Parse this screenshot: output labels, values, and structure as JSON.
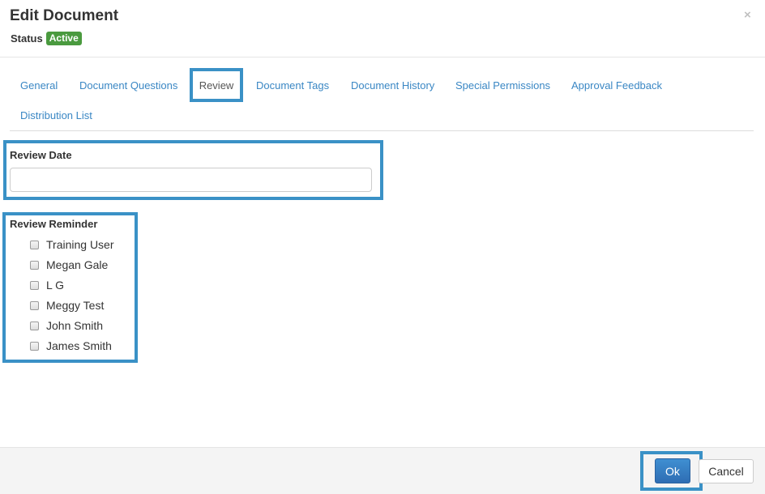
{
  "header": {
    "title": "Edit Document",
    "status_label": "Status",
    "status_badge": "Active",
    "close_glyph": "×"
  },
  "tabs": [
    {
      "label": "General"
    },
    {
      "label": "Document Questions"
    },
    {
      "label": "Review",
      "active": true
    },
    {
      "label": "Document Tags"
    },
    {
      "label": "Document History"
    },
    {
      "label": "Special Permissions"
    },
    {
      "label": "Approval Feedback"
    },
    {
      "label": "Distribution List"
    }
  ],
  "review": {
    "date_label": "Review Date",
    "date_value": "",
    "reminder_label": "Review Reminder",
    "users": [
      {
        "name": "Training User",
        "checked": false
      },
      {
        "name": "Megan Gale",
        "checked": false
      },
      {
        "name": "L G",
        "checked": false
      },
      {
        "name": "Meggy Test",
        "checked": false
      },
      {
        "name": "John Smith",
        "checked": false
      },
      {
        "name": "James Smith",
        "checked": false
      }
    ]
  },
  "footer": {
    "ok_label": "Ok",
    "cancel_label": "Cancel"
  },
  "colors": {
    "accent": "#3a91c6",
    "badge": "#4a9a3f",
    "link": "#3a87c4",
    "primary_button": "#337ab7"
  }
}
